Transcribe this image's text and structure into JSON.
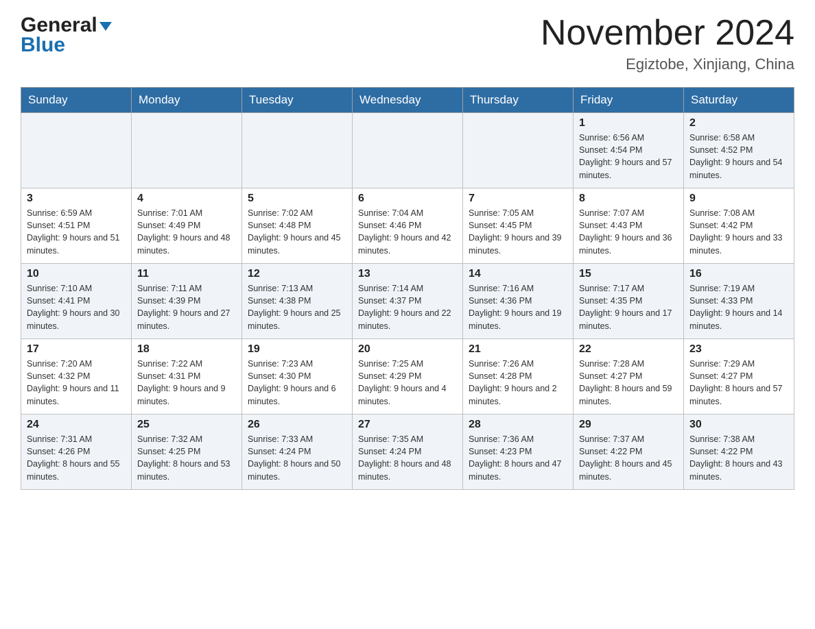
{
  "header": {
    "logo_text": "General",
    "logo_blue": "Blue",
    "month_title": "November 2024",
    "location": "Egiztobe, Xinjiang, China"
  },
  "weekdays": [
    "Sunday",
    "Monday",
    "Tuesday",
    "Wednesday",
    "Thursday",
    "Friday",
    "Saturday"
  ],
  "weeks": [
    [
      {
        "day": "",
        "info": ""
      },
      {
        "day": "",
        "info": ""
      },
      {
        "day": "",
        "info": ""
      },
      {
        "day": "",
        "info": ""
      },
      {
        "day": "",
        "info": ""
      },
      {
        "day": "1",
        "info": "Sunrise: 6:56 AM\nSunset: 4:54 PM\nDaylight: 9 hours and 57 minutes."
      },
      {
        "day": "2",
        "info": "Sunrise: 6:58 AM\nSunset: 4:52 PM\nDaylight: 9 hours and 54 minutes."
      }
    ],
    [
      {
        "day": "3",
        "info": "Sunrise: 6:59 AM\nSunset: 4:51 PM\nDaylight: 9 hours and 51 minutes."
      },
      {
        "day": "4",
        "info": "Sunrise: 7:01 AM\nSunset: 4:49 PM\nDaylight: 9 hours and 48 minutes."
      },
      {
        "day": "5",
        "info": "Sunrise: 7:02 AM\nSunset: 4:48 PM\nDaylight: 9 hours and 45 minutes."
      },
      {
        "day": "6",
        "info": "Sunrise: 7:04 AM\nSunset: 4:46 PM\nDaylight: 9 hours and 42 minutes."
      },
      {
        "day": "7",
        "info": "Sunrise: 7:05 AM\nSunset: 4:45 PM\nDaylight: 9 hours and 39 minutes."
      },
      {
        "day": "8",
        "info": "Sunrise: 7:07 AM\nSunset: 4:43 PM\nDaylight: 9 hours and 36 minutes."
      },
      {
        "day": "9",
        "info": "Sunrise: 7:08 AM\nSunset: 4:42 PM\nDaylight: 9 hours and 33 minutes."
      }
    ],
    [
      {
        "day": "10",
        "info": "Sunrise: 7:10 AM\nSunset: 4:41 PM\nDaylight: 9 hours and 30 minutes."
      },
      {
        "day": "11",
        "info": "Sunrise: 7:11 AM\nSunset: 4:39 PM\nDaylight: 9 hours and 27 minutes."
      },
      {
        "day": "12",
        "info": "Sunrise: 7:13 AM\nSunset: 4:38 PM\nDaylight: 9 hours and 25 minutes."
      },
      {
        "day": "13",
        "info": "Sunrise: 7:14 AM\nSunset: 4:37 PM\nDaylight: 9 hours and 22 minutes."
      },
      {
        "day": "14",
        "info": "Sunrise: 7:16 AM\nSunset: 4:36 PM\nDaylight: 9 hours and 19 minutes."
      },
      {
        "day": "15",
        "info": "Sunrise: 7:17 AM\nSunset: 4:35 PM\nDaylight: 9 hours and 17 minutes."
      },
      {
        "day": "16",
        "info": "Sunrise: 7:19 AM\nSunset: 4:33 PM\nDaylight: 9 hours and 14 minutes."
      }
    ],
    [
      {
        "day": "17",
        "info": "Sunrise: 7:20 AM\nSunset: 4:32 PM\nDaylight: 9 hours and 11 minutes."
      },
      {
        "day": "18",
        "info": "Sunrise: 7:22 AM\nSunset: 4:31 PM\nDaylight: 9 hours and 9 minutes."
      },
      {
        "day": "19",
        "info": "Sunrise: 7:23 AM\nSunset: 4:30 PM\nDaylight: 9 hours and 6 minutes."
      },
      {
        "day": "20",
        "info": "Sunrise: 7:25 AM\nSunset: 4:29 PM\nDaylight: 9 hours and 4 minutes."
      },
      {
        "day": "21",
        "info": "Sunrise: 7:26 AM\nSunset: 4:28 PM\nDaylight: 9 hours and 2 minutes."
      },
      {
        "day": "22",
        "info": "Sunrise: 7:28 AM\nSunset: 4:27 PM\nDaylight: 8 hours and 59 minutes."
      },
      {
        "day": "23",
        "info": "Sunrise: 7:29 AM\nSunset: 4:27 PM\nDaylight: 8 hours and 57 minutes."
      }
    ],
    [
      {
        "day": "24",
        "info": "Sunrise: 7:31 AM\nSunset: 4:26 PM\nDaylight: 8 hours and 55 minutes."
      },
      {
        "day": "25",
        "info": "Sunrise: 7:32 AM\nSunset: 4:25 PM\nDaylight: 8 hours and 53 minutes."
      },
      {
        "day": "26",
        "info": "Sunrise: 7:33 AM\nSunset: 4:24 PM\nDaylight: 8 hours and 50 minutes."
      },
      {
        "day": "27",
        "info": "Sunrise: 7:35 AM\nSunset: 4:24 PM\nDaylight: 8 hours and 48 minutes."
      },
      {
        "day": "28",
        "info": "Sunrise: 7:36 AM\nSunset: 4:23 PM\nDaylight: 8 hours and 47 minutes."
      },
      {
        "day": "29",
        "info": "Sunrise: 7:37 AM\nSunset: 4:22 PM\nDaylight: 8 hours and 45 minutes."
      },
      {
        "day": "30",
        "info": "Sunrise: 7:38 AM\nSunset: 4:22 PM\nDaylight: 8 hours and 43 minutes."
      }
    ]
  ]
}
